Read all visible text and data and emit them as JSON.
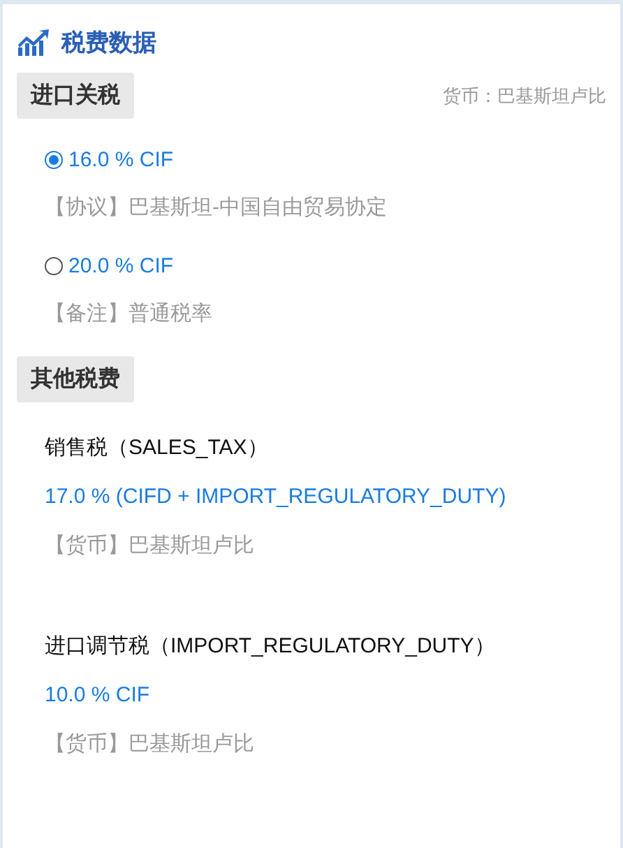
{
  "panel": {
    "title": "税费数据"
  },
  "import_duty": {
    "heading": "进口关税",
    "currency": "货币：巴基斯坦卢比",
    "options": [
      {
        "rate": "16.0 % CIF",
        "note": "【协议】巴基斯坦-中国自由贸易协定",
        "selected": true
      },
      {
        "rate": "20.0 % CIF",
        "note": "【备注】普通税率",
        "selected": false
      }
    ]
  },
  "other_taxes": {
    "heading": "其他税费",
    "items": [
      {
        "name": "销售税（SALES_TAX）",
        "rate": "17.0 % (CIFD + IMPORT_REGULATORY_DUTY)",
        "currency": "【货币】巴基斯坦卢比"
      },
      {
        "name": "进口调节税（IMPORT_REGULATORY_DUTY）",
        "rate": "10.0 % CIF",
        "currency": "【货币】巴基斯坦卢比"
      }
    ]
  }
}
